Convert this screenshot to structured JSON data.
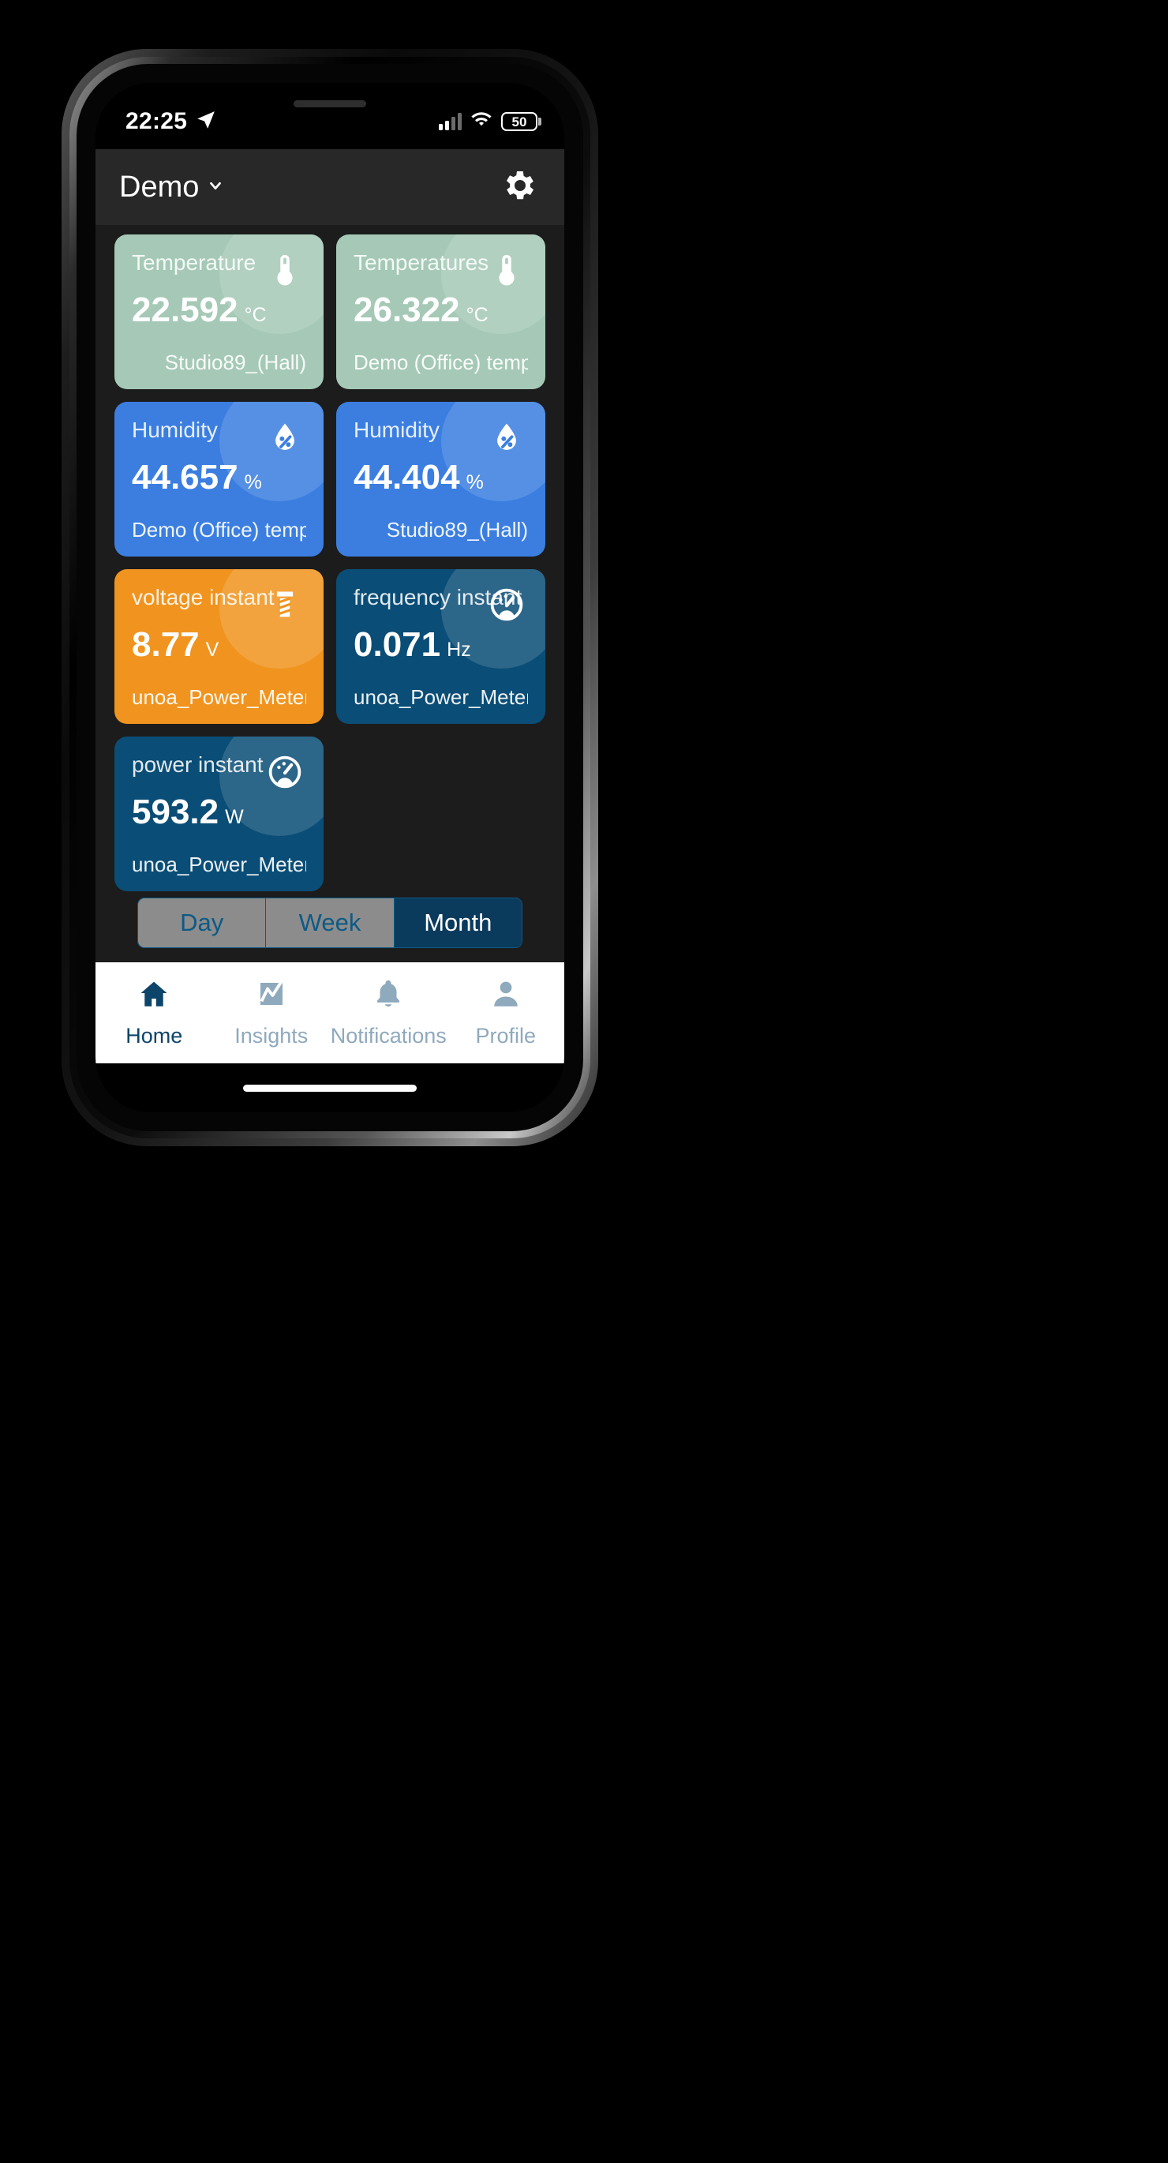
{
  "status_bar": {
    "time": "22:25",
    "location_icon": "location-arrow-icon",
    "signal_icon": "cellular-signal-icon",
    "wifi_icon": "wifi-icon",
    "battery_percent": "50",
    "battery_icon": "battery-icon"
  },
  "app_bar": {
    "title": "Demo",
    "dropdown_icon": "chevron-down-icon",
    "settings_icon": "gear-icon"
  },
  "colors": {
    "temperature": "#a5c9b6",
    "humidity": "#3b7ee0",
    "voltage": "#f0941f",
    "frequency": "#0a4d76",
    "power": "#0a4d76",
    "accent": "#0d4469",
    "segment_idle": "#8c8c8c",
    "segment_active": "#0a3a5c",
    "nav_inactive": "#8fa9bd"
  },
  "cards": [
    {
      "label": "Temperature",
      "value": "22.592",
      "unit": "°C",
      "source": "Studio89_(Hall)",
      "icon": "thermometer-icon",
      "color": "#a5c9b6",
      "align": "right"
    },
    {
      "label": "Temperatures",
      "value": "26.322",
      "unit": "°C",
      "source": "Demo (Office) temp",
      "icon": "thermometer-icon",
      "color": "#a5c9b6",
      "align": "right"
    },
    {
      "label": "Humidity",
      "value": "44.657",
      "unit": "%",
      "source": "Demo (Office) temp",
      "icon": "humidity-drop-icon",
      "color": "#3b7ee0",
      "align": "left"
    },
    {
      "label": "Humidity",
      "value": "44.404",
      "unit": "%",
      "source": "Studio89_(Hall)",
      "icon": "humidity-drop-icon",
      "color": "#3b7ee0",
      "align": "right"
    },
    {
      "label": "voltage instant",
      "value": "8.77",
      "unit": "V",
      "source": "unoa_Power_Meter",
      "icon": "voltage-bolt-icon",
      "color": "#f0941f",
      "align": "left"
    },
    {
      "label": "frequency instant",
      "value": "0.071",
      "unit": "Hz",
      "source": "unoa_Power_Meter",
      "icon": "gauge-icon",
      "color": "#0a4d76",
      "align": "left"
    },
    {
      "label": "power instant",
      "value": "593.2",
      "unit": "W",
      "source": "unoa_Power_Meter",
      "icon": "gauge-icon",
      "color": "#0a4d76",
      "align": "left"
    }
  ],
  "range_selector": {
    "options": [
      "Day",
      "Week",
      "Month"
    ],
    "selected": "Month"
  },
  "bottom_nav": {
    "items": [
      {
        "label": "Home",
        "icon": "home-icon",
        "active": true
      },
      {
        "label": "Insights",
        "icon": "chart-line-icon",
        "active": false
      },
      {
        "label": "Notifications",
        "icon": "bell-icon",
        "active": false
      },
      {
        "label": "Profile",
        "icon": "person-icon",
        "active": false
      }
    ]
  }
}
